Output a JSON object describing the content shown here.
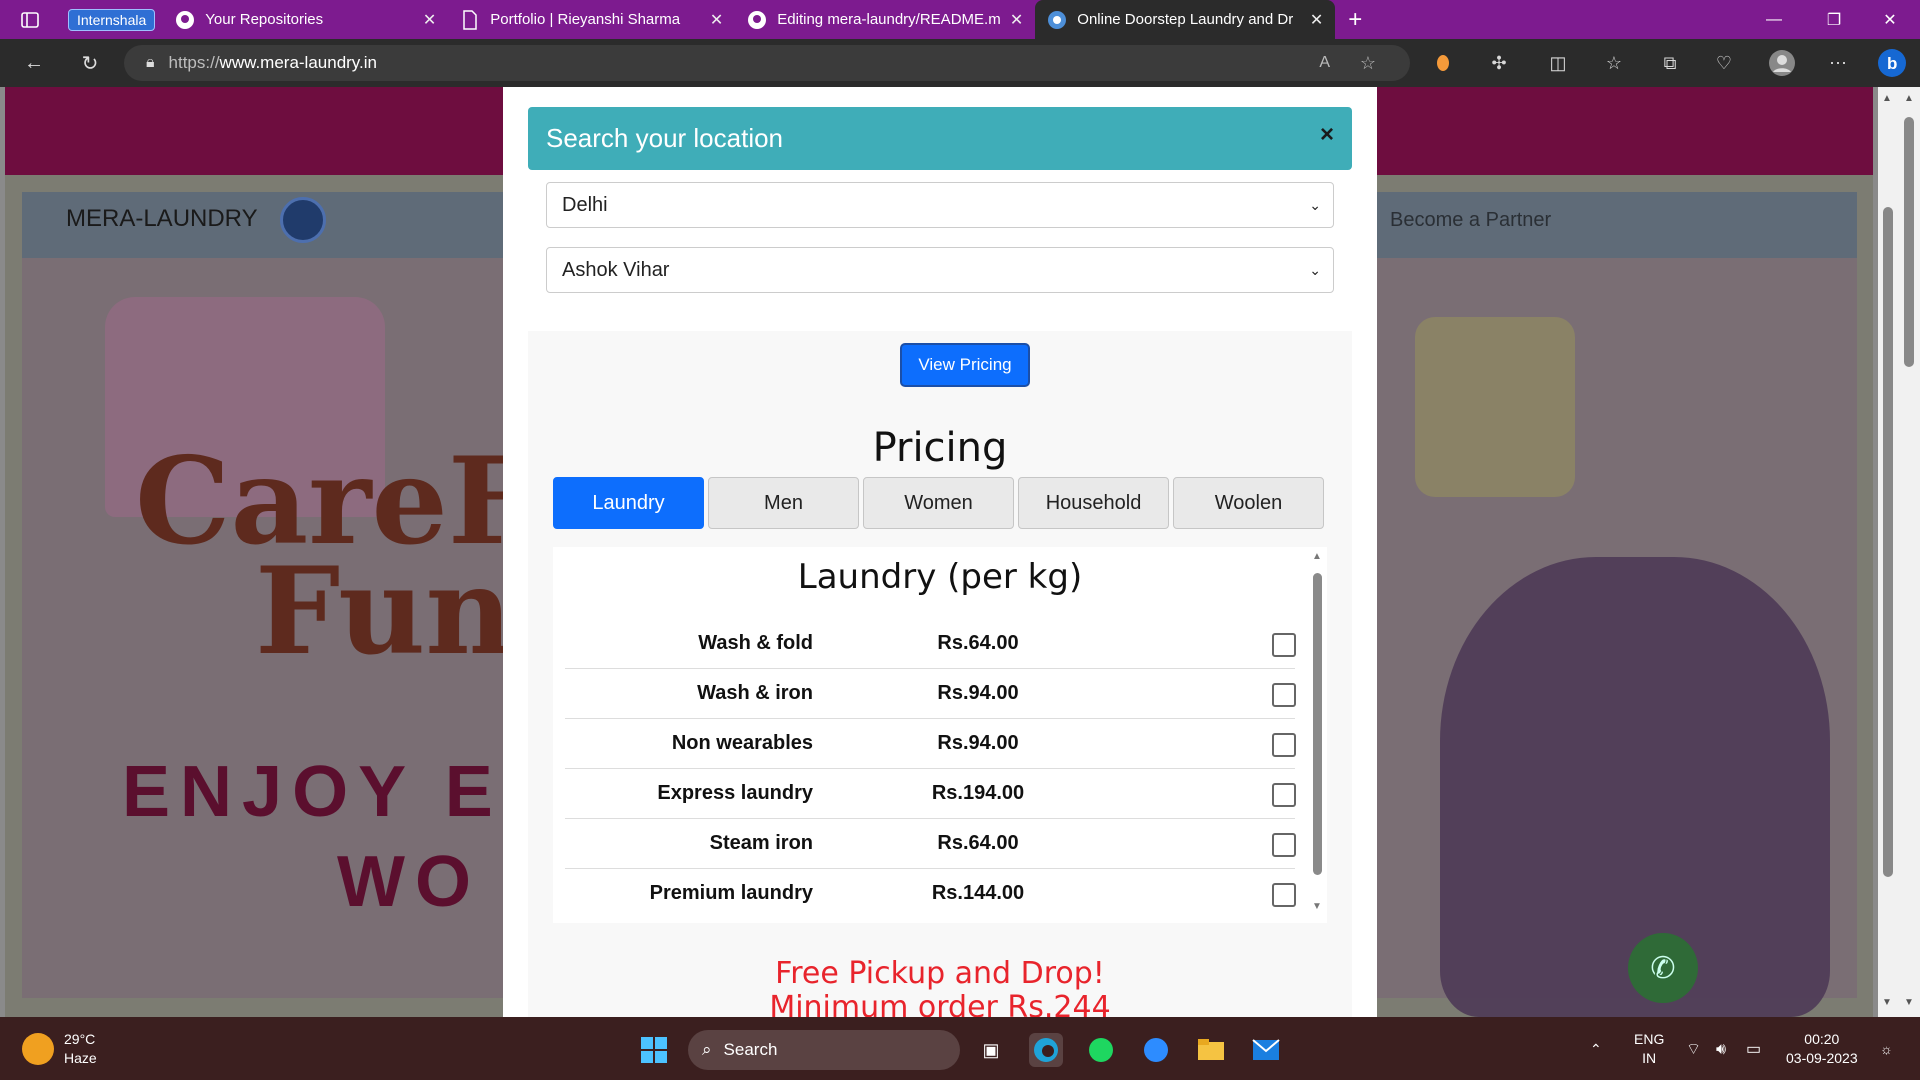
{
  "browser": {
    "tab_group_label": "Internshala",
    "tabs": [
      {
        "title": "Your Repositories",
        "icon": "github-icon"
      },
      {
        "title": "Portfolio | Rieyanshi Sharma",
        "icon": "page-icon"
      },
      {
        "title": "Editing mera-laundry/README.m",
        "icon": "github-icon"
      },
      {
        "title": "Online Doorstep Laundry and Dr",
        "icon": "laundry-site-icon",
        "active": true
      }
    ],
    "url_prefix": "https://",
    "url_host": "www.mera-laundry.in"
  },
  "site": {
    "brand": "MERA-LAUNDRY",
    "nav_partner": "Become a Partner",
    "hero_line1": "CareF",
    "hero_line2": "Fun",
    "hero_line3": "ENJOY E",
    "hero_line4": "WO"
  },
  "modal": {
    "title": "Search your location",
    "close": "×",
    "city": "Delhi",
    "area": "Ashok Vihar",
    "view_pricing": "View Pricing",
    "pricing_title": "Pricing",
    "tabs": [
      "Laundry",
      "Men",
      "Women",
      "Household",
      "Woolen"
    ],
    "active_tab": "Laundry",
    "list_title": "Laundry (per kg)",
    "items": [
      {
        "name": "Wash & fold",
        "price": "Rs.64.00"
      },
      {
        "name": "Wash & iron",
        "price": "Rs.94.00"
      },
      {
        "name": "Non wearables",
        "price": "Rs.94.00"
      },
      {
        "name": "Express laundry",
        "price": "Rs.194.00"
      },
      {
        "name": "Steam iron",
        "price": "Rs.64.00"
      },
      {
        "name": "Premium laundry",
        "price": "Rs.144.00"
      }
    ],
    "free_line1": "Free Pickup and Drop!",
    "free_line2": "Minimum order Rs.244"
  },
  "taskbar": {
    "temp": "29°C",
    "weather": "Haze",
    "search": "Search",
    "lang1": "ENG",
    "lang2": "IN",
    "time": "00:20",
    "date": "03-09-2023"
  }
}
